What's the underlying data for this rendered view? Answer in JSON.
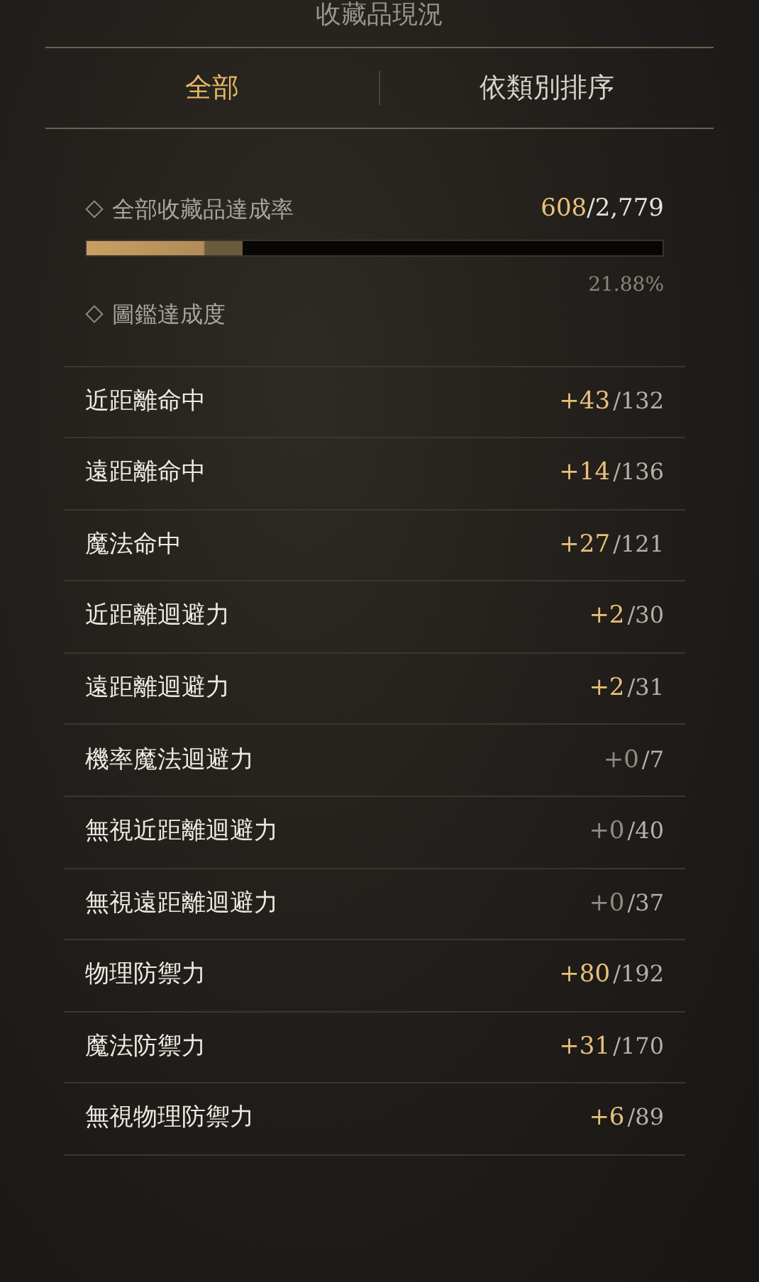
{
  "title": "收藏品現況",
  "tabs": [
    {
      "label": "全部",
      "selected": true
    },
    {
      "label": "依類別排序",
      "selected": false
    }
  ],
  "total": {
    "label": "全部收藏品達成率",
    "count": "608",
    "total": "/2,779",
    "level": 0.27,
    "percent": "21.88%"
  },
  "codex": {
    "label": "圖鑑達成度"
  },
  "stats": [
    {
      "name": "近距離命中",
      "bonus": "+43",
      "max": "/132",
      "highlight": true
    },
    {
      "name": "遠距離命中",
      "bonus": "+14",
      "max": "/136",
      "highlight": true
    },
    {
      "name": "魔法命中",
      "bonus": "+27",
      "max": "/121",
      "highlight": true
    },
    {
      "name": "近距離迴避力",
      "bonus": "+2",
      "max": "/30",
      "highlight": true
    },
    {
      "name": "遠距離迴避力",
      "bonus": "+2",
      "max": "/31",
      "highlight": true
    },
    {
      "name": "機率魔法迴避力",
      "bonus": "+0",
      "max": "/7",
      "highlight": false
    },
    {
      "name": "無視近距離迴避力",
      "bonus": "+0",
      "max": "/40",
      "highlight": false
    },
    {
      "name": "無視遠距離迴避力",
      "bonus": "+0",
      "max": "/37",
      "highlight": false
    },
    {
      "name": "物理防禦力",
      "bonus": "+80",
      "max": "/192",
      "highlight": true
    },
    {
      "name": "魔法防禦力",
      "bonus": "+31",
      "max": "/170",
      "highlight": true
    },
    {
      "name": "無視物理防禦力",
      "bonus": "+6",
      "max": "/89",
      "highlight": true
    }
  ]
}
